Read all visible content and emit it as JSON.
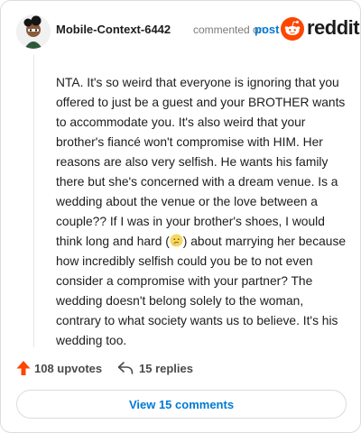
{
  "header": {
    "username": "Mobile-Context-6442",
    "action_text": "commented on",
    "post_link": "post",
    "brand": "reddit"
  },
  "comment": {
    "text_before_emoji": "NTA. It's so weird that everyone is ignoring that you offered to just be a guest and your BROTHER wants to accommodate you. It's also weird that your brother's fiancé won't compromise with HIM. Her reasons are also very selfish. He wants his family there but she's concerned with a dream venue. Is a wedding about the venue or the love between a couple?? If I was in your brother's shoes, I would think long and hard (",
    "emoji_icon": "thinking-face-icon",
    "text_after_emoji": ") about marrying her because how incredibly selfish could you be to not even consider a compromise with your partner? The wedding doesn't belong solely to the woman, contrary to what society wants us to believe. It's his wedding too."
  },
  "actions": {
    "upvotes": "108 upvotes",
    "replies": "15 replies"
  },
  "footer": {
    "view_comments": "View 15 comments"
  },
  "colors": {
    "upvote": "#ff4500",
    "link": "#0079d3",
    "brand": "#ff4500",
    "border": "#d9dde0"
  }
}
